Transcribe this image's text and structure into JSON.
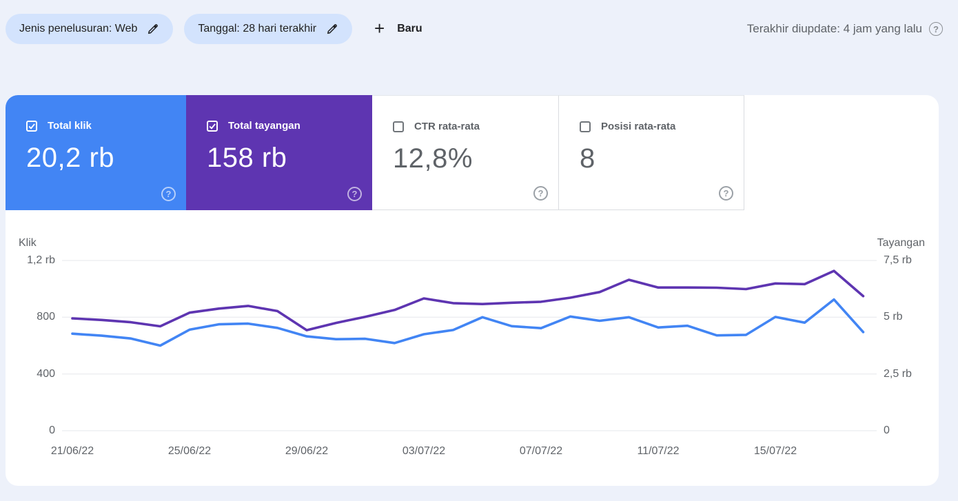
{
  "filters": {
    "search_type": "Jenis penelusuran: Web",
    "date": "Tanggal: 28 hari terakhir",
    "new_label": "Baru"
  },
  "header": {
    "last_updated": "Terakhir diupdate: 4 jam yang lalu",
    "help_glyph": "?"
  },
  "cards": [
    {
      "label": "Total klik",
      "value": "20,2 rb",
      "checked": true,
      "bg": "#4285f4"
    },
    {
      "label": "Total tayangan",
      "value": "158 rb",
      "checked": true,
      "bg": "#5e35b1"
    },
    {
      "label": "CTR rata-rata",
      "value": "12,8%",
      "checked": false,
      "bg": "#ffffff"
    },
    {
      "label": "Posisi rata-rata",
      "value": "8",
      "checked": false,
      "bg": "#ffffff"
    }
  ],
  "chart_data": {
    "type": "line",
    "x": [
      "21/06/22",
      "22/06/22",
      "23/06/22",
      "24/06/22",
      "25/06/22",
      "26/06/22",
      "27/06/22",
      "28/06/22",
      "29/06/22",
      "30/06/22",
      "01/07/22",
      "02/07/22",
      "03/07/22",
      "04/07/22",
      "05/07/22",
      "06/07/22",
      "07/07/22",
      "08/07/22",
      "09/07/22",
      "10/07/22",
      "11/07/22",
      "12/07/22",
      "13/07/22",
      "14/07/22",
      "15/07/22",
      "16/07/22",
      "17/07/22",
      "18/07/22"
    ],
    "series": [
      {
        "name": "Klik",
        "axis": "left",
        "color": "#4285f4",
        "values": [
          684,
          670,
          650,
          600,
          712,
          750,
          755,
          725,
          665,
          645,
          648,
          618,
          680,
          710,
          800,
          737,
          723,
          805,
          775,
          800,
          728,
          740,
          672,
          676,
          802,
          762,
          925,
          695
        ]
      },
      {
        "name": "Tayangan",
        "axis": "right",
        "color": "#5e35b1",
        "values": [
          4950,
          4880,
          4780,
          4600,
          5200,
          5380,
          5500,
          5270,
          4430,
          4750,
          5020,
          5320,
          5830,
          5620,
          5580,
          5640,
          5680,
          5860,
          6110,
          6650,
          6310,
          6310,
          6300,
          6240,
          6490,
          6460,
          7040,
          5930
        ]
      }
    ],
    "left_axis": {
      "title": "Klik",
      "max": 1200,
      "ticks": [
        {
          "label": "0",
          "value": 0
        },
        {
          "label": "400",
          "value": 400
        },
        {
          "label": "800",
          "value": 800
        },
        {
          "label": "1,2 rb",
          "value": 1200
        }
      ]
    },
    "right_axis": {
      "title": "Tayangan",
      "max": 7500,
      "ticks": [
        {
          "label": "0",
          "value": 0
        },
        {
          "label": "2,5 rb",
          "value": 2500
        },
        {
          "label": "5 rb",
          "value": 5000
        },
        {
          "label": "7,5 rb",
          "value": 7500
        }
      ]
    },
    "x_ticks": [
      {
        "label": "21/06/22",
        "day": 0
      },
      {
        "label": "25/06/22",
        "day": 4
      },
      {
        "label": "29/06/22",
        "day": 8
      },
      {
        "label": "03/07/22",
        "day": 12
      },
      {
        "label": "07/07/22",
        "day": 16
      },
      {
        "label": "11/07/22",
        "day": 20
      },
      {
        "label": "15/07/22",
        "day": 24
      }
    ],
    "grid": true,
    "legend_position": "none"
  }
}
